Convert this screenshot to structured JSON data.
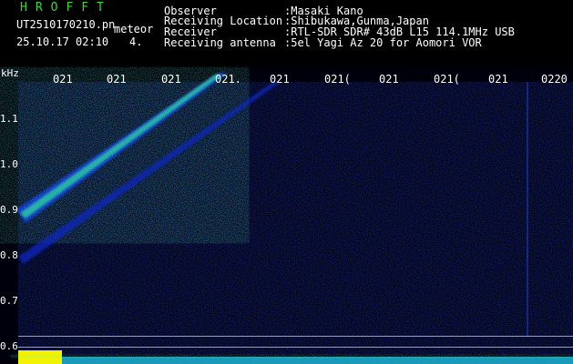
{
  "header": {
    "app_title": "HROFFT",
    "filename": "UT2510170210.pn",
    "mode": "meteor",
    "datetime": "25.10.17 02:10",
    "counter": "4."
  },
  "station": {
    "rows": [
      {
        "label": "Observer",
        "value": ":Masaki Kano"
      },
      {
        "label": "Receiving Location",
        "value": ":Shibukawa,Gunma,Japan"
      },
      {
        "label": "Receiver",
        "value": ":RTL-SDR SDR# 43dB L15 114.1MHz USB"
      },
      {
        "label": "Receiving antenna",
        "value": ":5el Yagi Az 20 for Aomori VOR"
      }
    ]
  },
  "axis": {
    "unit": "kHz",
    "y_ticks": [
      "1.1",
      "1.0",
      "0.9",
      "0.8",
      "0.7",
      "0.6"
    ],
    "x_ticks": [
      "021",
      "021",
      "021",
      "021.",
      "021",
      "021(",
      "021",
      "021(",
      "021",
      "0220"
    ]
  }
}
